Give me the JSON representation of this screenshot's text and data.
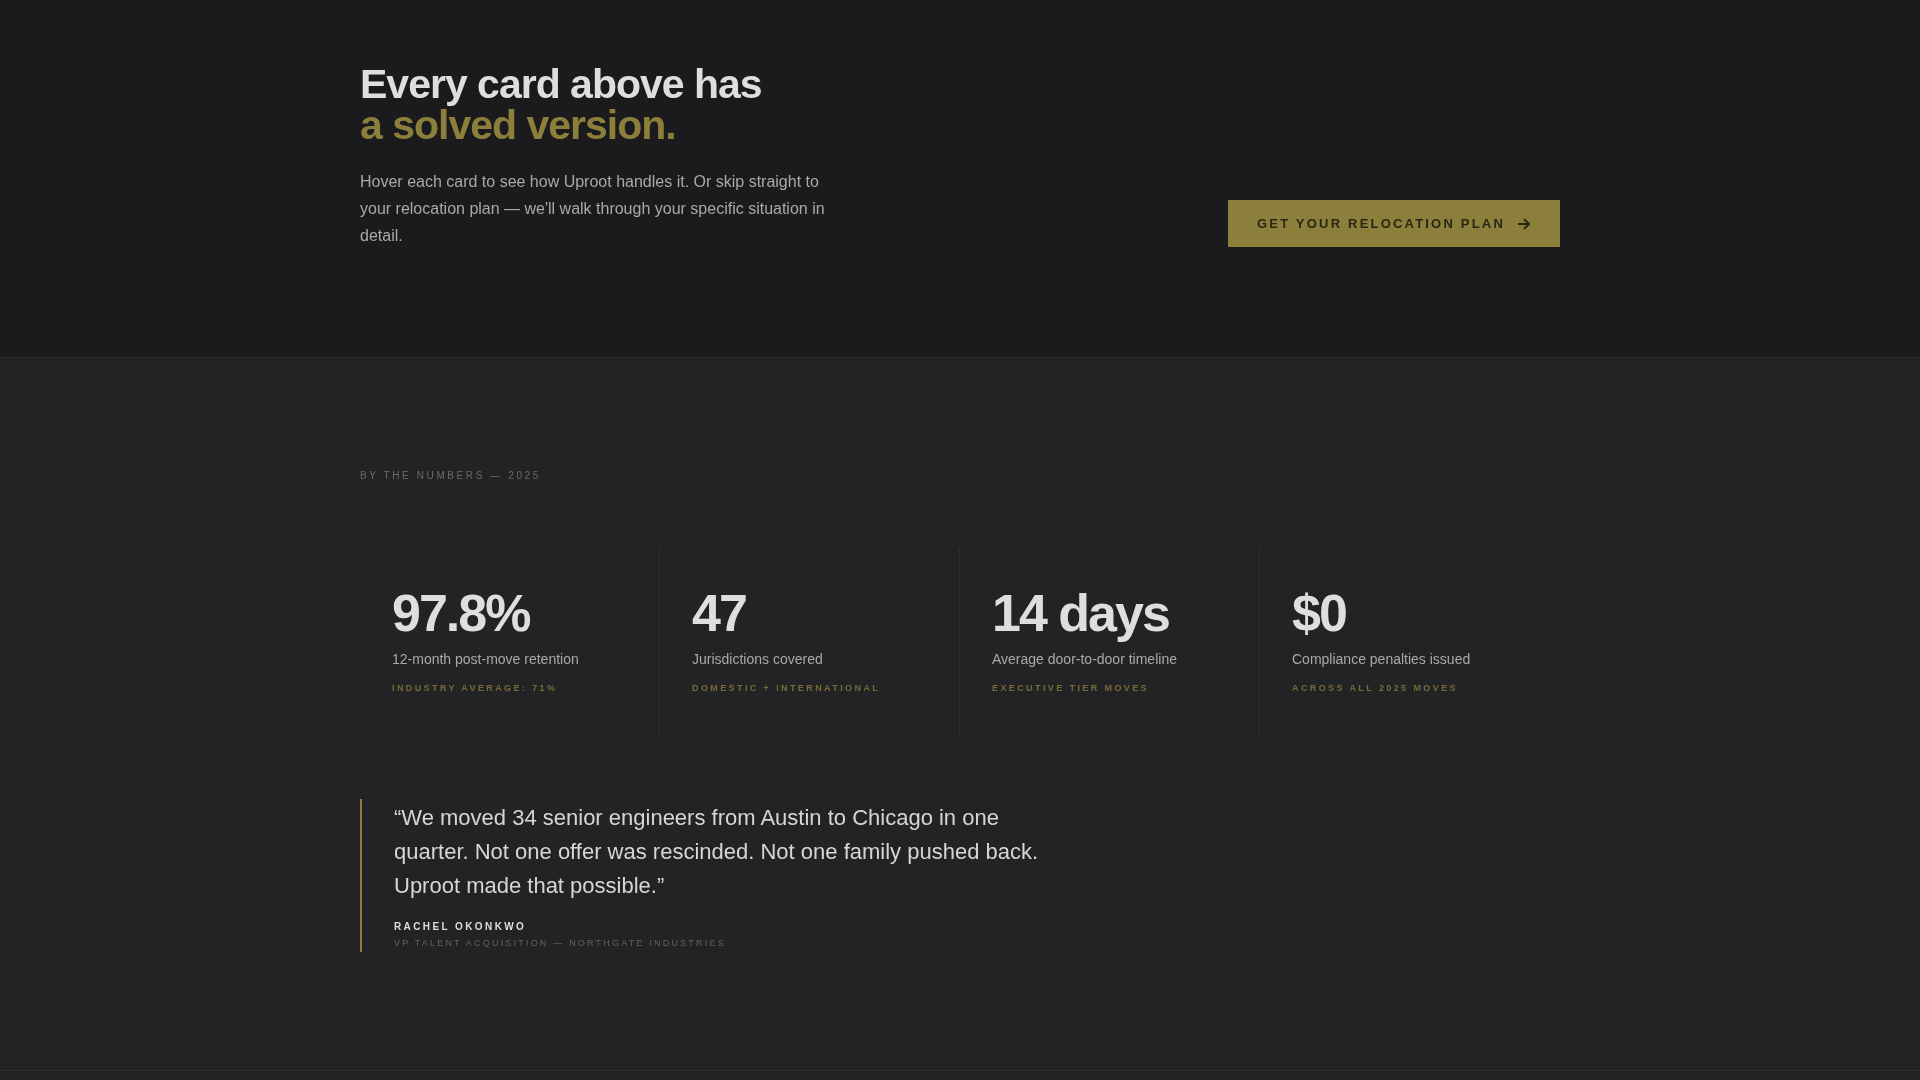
{
  "cta": {
    "title_line_1": "Every card above has",
    "title_line_2": "a solved version.",
    "body": "Hover each card to see how Uproot handles it. Or skip straight to your relocation plan — we'll walk through your specific situation in detail.",
    "button": "GET YOUR RELOCATION PLAN"
  },
  "numbers": {
    "eyebrow": "BY THE NUMBERS — 2025",
    "stats": [
      {
        "value": "97.8%",
        "label": "12-month post-move retention",
        "note": "INDUSTRY AVERAGE: 71%"
      },
      {
        "value": "47",
        "label": "Jurisdictions covered",
        "note": "DOMESTIC + INTERNATIONAL"
      },
      {
        "value": "14 days",
        "label": "Average door-to-door timeline",
        "note": "EXECUTIVE TIER MOVES"
      },
      {
        "value": "$0",
        "label": "Compliance penalties issued",
        "note": "ACROSS ALL 2025 MOVES"
      }
    ],
    "testimonial": {
      "quote": "“We moved 34 senior engineers from Austin to Chicago in one quarter. Not one offer was rescinded. Not one family pushed back. Uproot made that possible.”",
      "name": "RACHEL OKONKWO",
      "role": "VP TALENT ACQUISITION — NORTHGATE INDUSTRIES"
    }
  }
}
